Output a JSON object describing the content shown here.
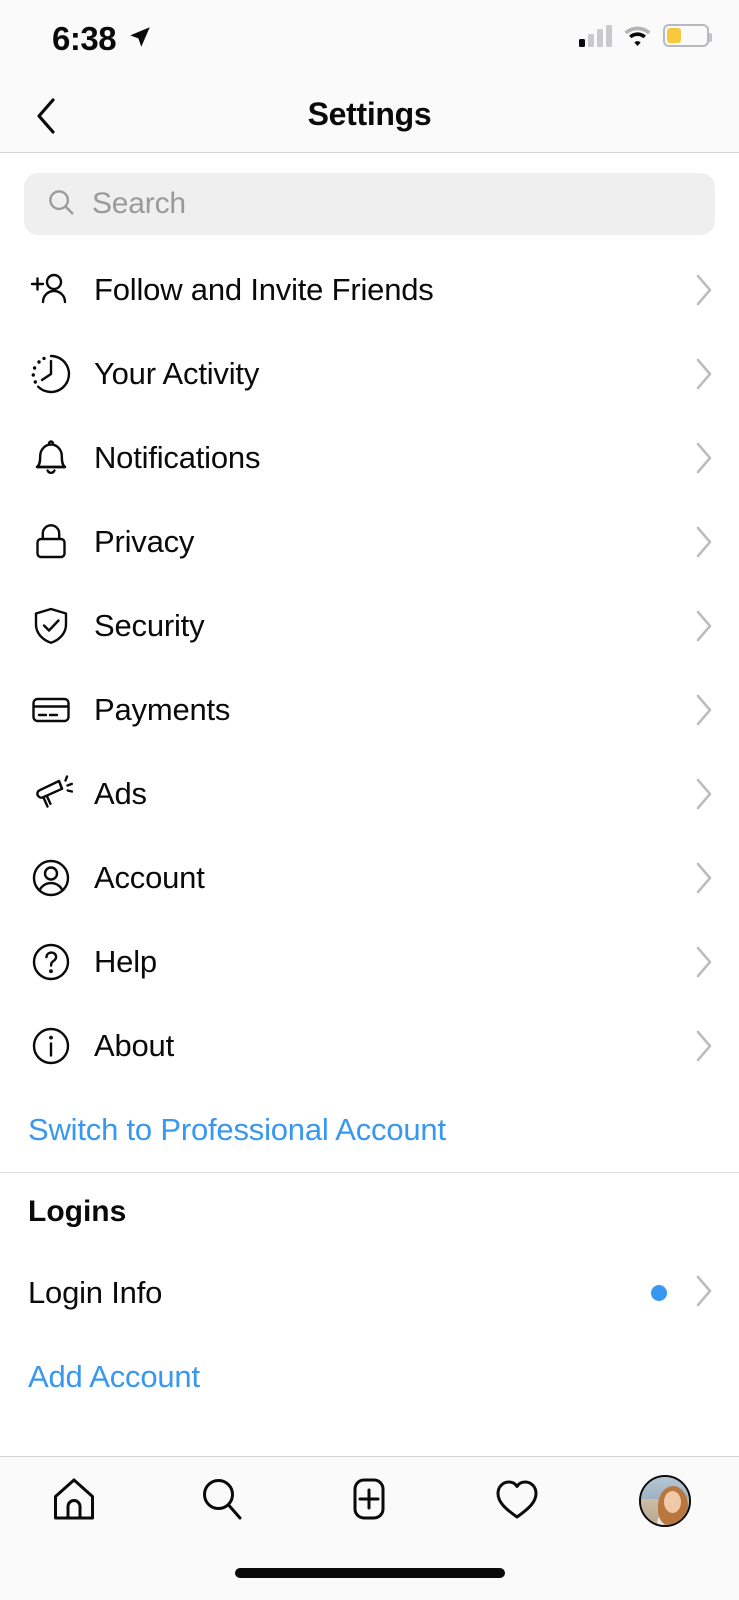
{
  "status_bar": {
    "time": "6:38",
    "location_icon": "location-arrow-icon",
    "signal_icon": "cellular-signal-icon",
    "signal_bars_filled": 1,
    "signal_bars_total": 4,
    "wifi_icon": "wifi-icon",
    "battery_icon": "battery-icon",
    "battery_level_percent": 33,
    "battery_color": "#f8c83c"
  },
  "nav": {
    "back_icon": "chevron-left-icon",
    "title": "Settings"
  },
  "search": {
    "icon": "search-icon",
    "placeholder": "Search",
    "value": ""
  },
  "settings_items": [
    {
      "label": "Follow and Invite Friends",
      "icon": "person-add-icon"
    },
    {
      "label": "Your Activity",
      "icon": "clock-activity-icon"
    },
    {
      "label": "Notifications",
      "icon": "bell-icon"
    },
    {
      "label": "Privacy",
      "icon": "lock-icon"
    },
    {
      "label": "Security",
      "icon": "shield-check-icon"
    },
    {
      "label": "Payments",
      "icon": "credit-card-icon"
    },
    {
      "label": "Ads",
      "icon": "megaphone-icon"
    },
    {
      "label": "Account",
      "icon": "person-circle-icon"
    },
    {
      "label": "Help",
      "icon": "question-circle-icon"
    },
    {
      "label": "About",
      "icon": "info-circle-icon"
    }
  ],
  "switch_professional": {
    "label": "Switch to Professional Account",
    "color": "#3897f0"
  },
  "logins_section": {
    "title": "Logins",
    "login_info": {
      "label": "Login Info",
      "badge_icon": "blue-dot-badge",
      "badge_color": "#3897f0"
    },
    "add_account": {
      "label": "Add Account",
      "color": "#3897f0"
    }
  },
  "tab_bar": {
    "tabs": [
      {
        "name": "home",
        "icon": "home-icon"
      },
      {
        "name": "search",
        "icon": "search-icon"
      },
      {
        "name": "create",
        "icon": "plus-square-icon"
      },
      {
        "name": "activity",
        "icon": "heart-icon"
      },
      {
        "name": "profile",
        "icon": "profile-avatar"
      }
    ],
    "home_indicator": "home-indicator-bar"
  },
  "chevron_icon": "chevron-right-icon"
}
